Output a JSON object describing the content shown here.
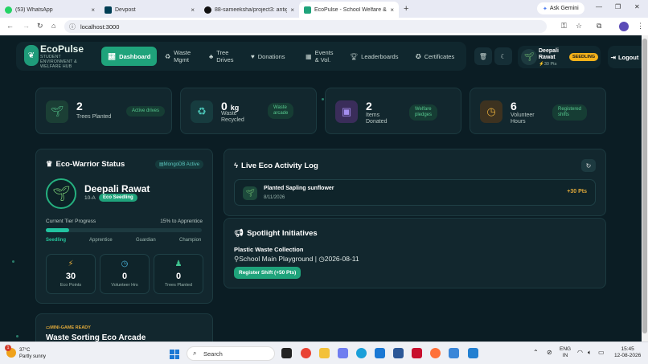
{
  "browser": {
    "tabs": [
      {
        "label": "(53) WhatsApp",
        "color": "#25D366"
      },
      {
        "label": "Devpost",
        "color": "#003e54"
      },
      {
        "label": "88-sameeksha/project3: antigr...",
        "color": "#111111"
      },
      {
        "label": "EcoPulse - School Welfare & Env...",
        "color": "#1fa37b"
      }
    ],
    "new_tab": "+",
    "close_glyph": "×",
    "gemini": "Ask Gemini",
    "url": "localhost:3000"
  },
  "app": {
    "brand": {
      "name": "EcoPulse",
      "subtitle_lines": [
        "STUDENT",
        "ENVIRONMENT &",
        "WELFARE HUB"
      ]
    },
    "nav": {
      "items": [
        {
          "label": "Dashboard",
          "icon": "chart-icon"
        },
        {
          "label_lines": [
            "Waste",
            "Mgmt"
          ],
          "icon": "recycle-icon"
        },
        {
          "label_lines": [
            "Tree",
            "Drives"
          ],
          "icon": "tree-icon"
        },
        {
          "label": "Donations",
          "icon": "hand-heart-icon"
        },
        {
          "label_lines": [
            "Events",
            "& Vol."
          ],
          "icon": "calendar-icon"
        },
        {
          "label": "Leaderboards",
          "icon": "trophy-icon"
        },
        {
          "label": "Certificates",
          "icon": "award-icon"
        }
      ]
    },
    "user": {
      "name_lines": [
        "Deepali",
        "Rawat"
      ],
      "points": "⚡30 Pts",
      "tier": "SEEDLING"
    },
    "logout": "Logout",
    "stats": [
      {
        "value": "2",
        "unit": "",
        "label_lines": [
          "Trees Planted"
        ],
        "pill_lines": [
          "Active drives"
        ],
        "icon": "sprout-icon",
        "color": "#1b3f35",
        "glyph_color": "#57c98f"
      },
      {
        "value": "0",
        "unit": "kg",
        "label_lines": [
          "Waste",
          "Recycled"
        ],
        "pill_lines": [
          "Waste",
          "arcade"
        ],
        "icon": "recycle-icon",
        "color": "#173c3f",
        "glyph_color": "#4cc6b8"
      },
      {
        "value": "2",
        "unit": "",
        "label_lines": [
          "Items",
          "Donated"
        ],
        "pill_lines": [
          "Welfare",
          "pledges"
        ],
        "icon": "gift-box-icon",
        "color": "#3a2d5a",
        "glyph_color": "#a58ef0"
      },
      {
        "value": "6",
        "unit": "",
        "label_lines": [
          "Volunteer",
          "Hours"
        ],
        "pill_lines": [
          "Registered",
          "shifts"
        ],
        "icon": "clock-icon",
        "color": "#3d3220",
        "glyph_color": "#e0a93a"
      }
    ],
    "status": {
      "title": "Eco-Warrior Status",
      "db_badge": "MongoDB Active",
      "name": "Deepali Rawat",
      "class": "10-A",
      "tier_badge": "Eco Seedling",
      "tier_label": "Current Tier Progress",
      "tier_to_next": "15% to Apprentice",
      "progress": 0.15,
      "tiers": [
        "Seedling",
        "Apprentice",
        "Guardian",
        "Champion"
      ],
      "tiles": [
        {
          "icon": "lightning-icon",
          "value": "30",
          "label": "Eco Points",
          "color": "#e0a93a"
        },
        {
          "icon": "clock-icon",
          "value": "0",
          "label": "Volunteer Hrs",
          "color": "#4cb8e0"
        },
        {
          "icon": "bell-icon",
          "value": "0",
          "label": "Trees Planted",
          "color": "#3fc38f"
        }
      ]
    },
    "activity": {
      "title": "Live Eco Activity Log",
      "entries": [
        {
          "title": "Planted Sapling sunflower",
          "date": "8/11/2026",
          "points": "+30 Pts"
        }
      ]
    },
    "spotlight": {
      "title": "Spotlight Initiatives",
      "initiative": "Plastic Waste Collection",
      "location": "School Main Playground",
      "date": "2026-08-11",
      "button": "Register Shift (+50 Pts)"
    },
    "game": {
      "tag": "MINI-GAME READY",
      "title": "Waste Sorting Eco Arcade"
    }
  },
  "taskbar": {
    "weather": {
      "temp": "37°C",
      "cond": "Partly sunny",
      "badge": "1"
    },
    "search": "Search",
    "lang": [
      "ENG",
      "IN"
    ],
    "time": "15:45",
    "date": "12-08-2026"
  }
}
